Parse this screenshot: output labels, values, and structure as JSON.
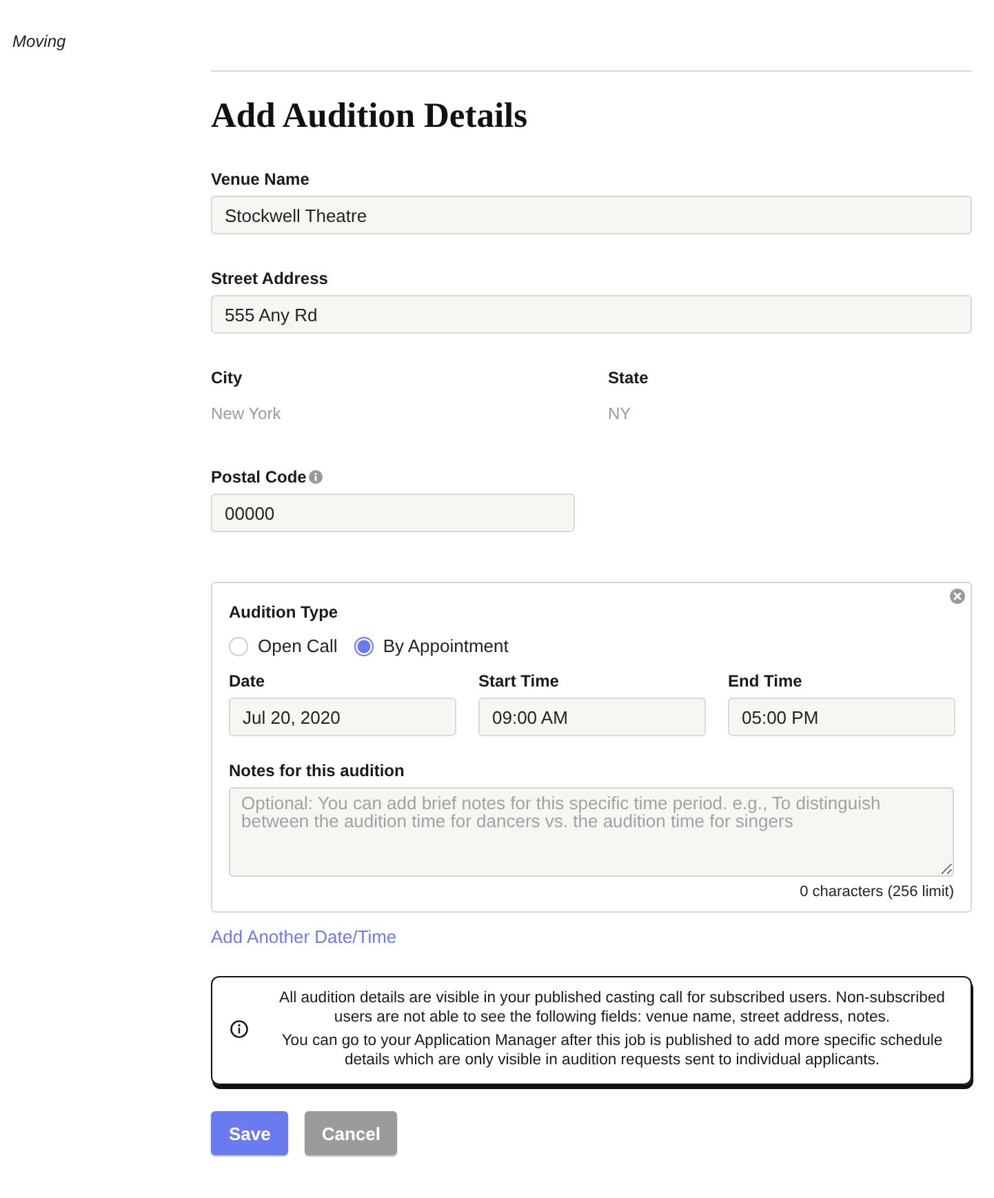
{
  "breadcrumb": "Moving",
  "heading": "Add Audition Details",
  "venue_name": {
    "label": "Venue Name",
    "value": "Stockwell Theatre"
  },
  "street_address": {
    "label": "Street Address",
    "value": "555 Any Rd"
  },
  "location": [
    {
      "label": "City",
      "value": "New York",
      "disabled": true
    },
    {
      "label": "State",
      "value": "NY",
      "disabled": true
    }
  ],
  "postal_code": {
    "label": "Postal Code",
    "value": "00000"
  },
  "audition": {
    "type_label": "Audition Type",
    "types": [
      {
        "label": "Open Call",
        "selected": false
      },
      {
        "label": "By Appointment",
        "selected": true
      }
    ],
    "schedule": [
      {
        "label": "Date",
        "value": "Jul 20, 2020"
      },
      {
        "label": "Start Time",
        "value": "09:00 AM"
      },
      {
        "label": "End Time",
        "value": "05:00 PM"
      }
    ],
    "notes": {
      "label": "Notes for this audition",
      "placeholder": "Optional: You can add brief notes for this specific time period. e.g., To distinguish between the audition time for dancers vs. the audition time for singers",
      "counter": "0 characters (256 limit)"
    }
  },
  "add_link": "Add Another Date/Time",
  "notice": [
    "All audition details are visible in your published casting call for subscribed users. Non-subscribed users are not able to see the following fields: venue name, street address, notes.",
    "You can go to your Application Manager after this job is published to add more specific schedule details which are only visible in audition requests sent to individual applicants."
  ],
  "buttons": [
    {
      "label": "Save",
      "kind": "primary"
    },
    {
      "label": "Cancel",
      "kind": "secondary"
    }
  ]
}
